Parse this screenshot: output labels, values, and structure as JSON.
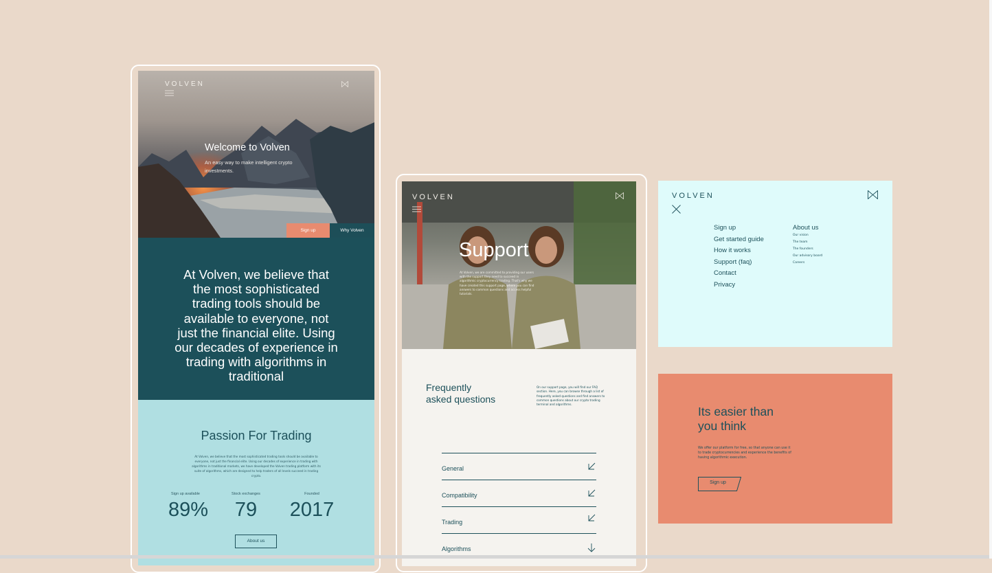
{
  "phone1": {
    "brand": "VOLVEN",
    "hero_title": "Welcome to Volven",
    "hero_subtitle": "An easy way to make intelligent crypto investments.",
    "signup_label": "Sign up",
    "why_label": "Why Volven",
    "belief_text": "At Volven, we believe that the most sophisticated trading tools should be available to everyone, not just the financial elite. Using our decades of experience in trading with algorithms in traditional",
    "passion_title": "Passion For Trading",
    "passion_text": "At Volven, we believe that the most sophisticated trading tools should be available to everyone, not just the financial elite. Using our decades of experience in trading with algorithms in traditional markets, we have developed the Volven trading platform with its suite of algorithms, which are designed to help traders of all levels succeed in trading crypto.",
    "stats": [
      {
        "label": "Sign up available",
        "value": "89%"
      },
      {
        "label": "Stock exchanges",
        "value": "79"
      },
      {
        "label": "Founded",
        "value": "2017"
      }
    ],
    "about_label": "About us"
  },
  "phone2": {
    "brand": "VOLVEN",
    "hero_title": "Support",
    "hero_text": "At Volven, we are committed to providing our users with the support they need to succeed in algorithmic cryptocurrency trading. That's why we have created this support page, where you can find answers to common questions and access helpful tutorials.",
    "faq_title_line1": "Frequently",
    "faq_title_line2": "asked questions",
    "faq_text": "On our support page, you will find our FAQ section. Here, you can browse through a list of frequently asked questions and find answers to common questions about our crypto trading terminal and algorithms.",
    "faq_items": [
      "General",
      "Compatibility",
      "Trading",
      "Algorithms"
    ]
  },
  "menu": {
    "brand": "VOLVEN",
    "main_items": [
      "Sign up",
      "Get started guide",
      "How it works",
      "Support (faq)",
      "Contact",
      "Privacy"
    ],
    "about_title": "About us",
    "about_items": [
      "Our vision",
      "The team",
      "The founders",
      "Our advisory board",
      "Careers"
    ]
  },
  "promo": {
    "title_line1": "Its easier than",
    "title_line2": "you think",
    "text": "We offer our platform for free, so that anyone can use it to trade cryptocurrencies and experience the benefits of having algorithmic execution.",
    "button_label": "Sign up"
  },
  "colors": {
    "background": "#ead9ca",
    "dark_teal": "#1c505a",
    "light_teal": "#b0dfe2",
    "coral": "#e88b6f",
    "menu_bg": "#dffbfb",
    "support_bg": "#f5f3ef"
  },
  "icons": [
    "hamburger-icon",
    "volven-logo-icon",
    "close-icon",
    "arrow-down-left-icon",
    "arrow-down-icon"
  ]
}
